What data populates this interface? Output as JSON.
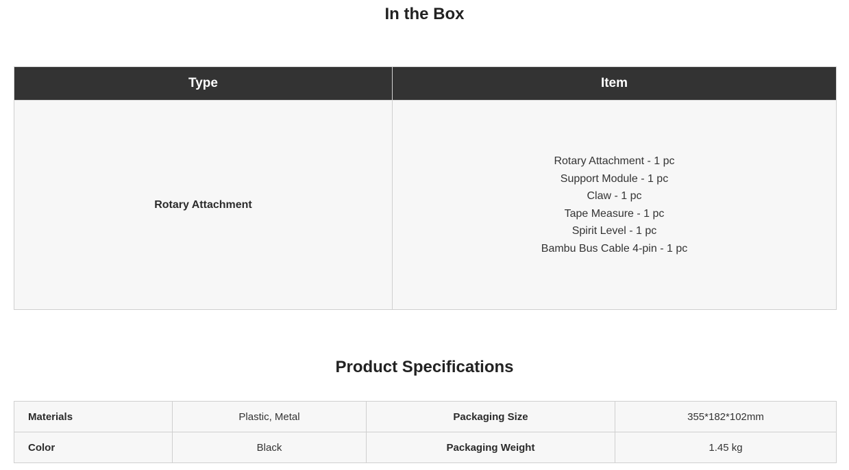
{
  "in_the_box": {
    "title": "In the Box",
    "headers": {
      "type": "Type",
      "item": "Item"
    },
    "type_value": "Rotary Attachment",
    "items": [
      "Rotary Attachment - 1 pc",
      "Support Module - 1 pc",
      "Claw - 1 pc",
      "Tape Measure - 1 pc",
      "Spirit Level - 1 pc",
      "Bambu Bus Cable 4-pin - 1 pc"
    ]
  },
  "specifications": {
    "title": "Product Specifications",
    "rows": [
      {
        "label1": "Materials",
        "value1": "Plastic, Metal",
        "label2": "Packaging Size",
        "value2": "355*182*102mm"
      },
      {
        "label1": "Color",
        "value1": "Black",
        "label2": "Packaging Weight",
        "value2": "1.45 kg"
      }
    ]
  },
  "colors": {
    "header_bg": "#333333",
    "cell_bg": "#f7f7f7",
    "border": "#cfcfcf"
  }
}
